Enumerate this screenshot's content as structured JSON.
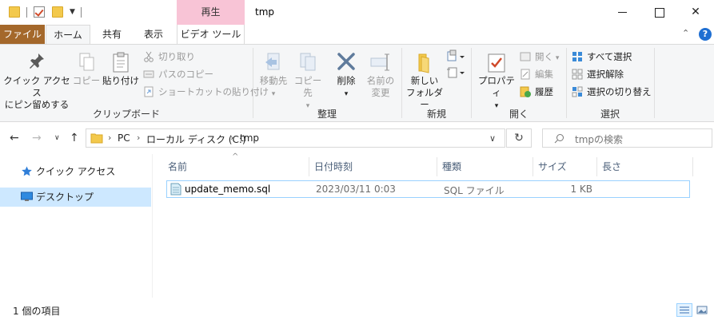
{
  "window": {
    "title": "tmp",
    "context_tab_group": "再生",
    "controls": {
      "minimize": "",
      "maximize": "",
      "close": "✕"
    }
  },
  "tabs": {
    "file": "ファイル",
    "home": "ホーム",
    "share": "共有",
    "view": "表示",
    "video_tools": "ビデオ ツール"
  },
  "ribbon": {
    "clipboard": {
      "label": "クリップボード",
      "pin_quick_access": "クイック アクセス",
      "pin_quick_access_2": "にピン留めする",
      "copy": "コピー",
      "paste": "貼り付け",
      "cut": "切り取り",
      "copy_path": "パスのコピー",
      "paste_shortcut": "ショートカットの貼り付け"
    },
    "organize": {
      "label": "整理",
      "move_to": "移動先",
      "copy_to": "コピー先",
      "delete": "削除",
      "rename": "名前の",
      "rename_2": "変更"
    },
    "new": {
      "label": "新規",
      "new_folder": "新しい",
      "new_folder_2": "フォルダー"
    },
    "open": {
      "label": "開く",
      "properties": "プロパティ",
      "open": "開く",
      "edit": "編集",
      "history": "履歴"
    },
    "select": {
      "label": "選択",
      "select_all": "すべて選択",
      "select_none": "選択解除",
      "invert_selection": "選択の切り替え"
    }
  },
  "address": {
    "crumbs": [
      "PC",
      "ローカル ディスク (C:)",
      "tmp"
    ],
    "search_placeholder": "tmpの検索"
  },
  "nav_pane": {
    "items": [
      {
        "label": "クイック アクセス"
      },
      {
        "label": "デスクトップ"
      }
    ]
  },
  "file_list": {
    "columns": [
      "名前",
      "日付時刻",
      "種類",
      "サイズ",
      "長さ"
    ],
    "rows": [
      {
        "name": "update_memo.sql",
        "date": "2023/03/11 0:03",
        "type": "SQL ファイル",
        "size": "1 KB",
        "length": ""
      }
    ]
  },
  "status": {
    "item_count": "1 個の項目"
  },
  "colors": {
    "file_tab": "#a4682b",
    "context_tab": "#f8c4d6",
    "selection": "#cde8ff",
    "accent_blue": "#1f6fd2"
  }
}
